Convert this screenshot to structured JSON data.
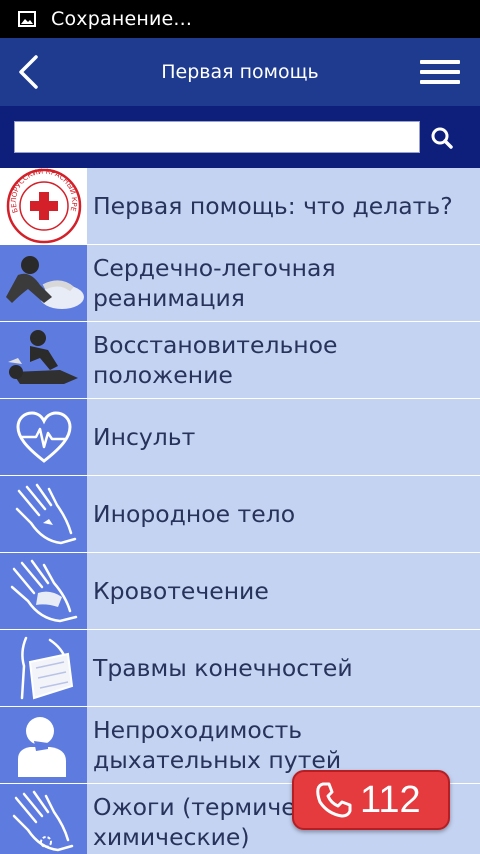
{
  "status_bar": {
    "text": "Сохранение...",
    "icon": "image-icon"
  },
  "header": {
    "title": "Первая помощь",
    "back_icon": "chevron-left-icon",
    "menu_icon": "hamburger-menu-icon",
    "bg_color": "#1f3b8f"
  },
  "search": {
    "value": "",
    "placeholder": "",
    "icon": "search-icon"
  },
  "list": {
    "items": [
      {
        "label": "Первая помощь: что делать?",
        "icon": "red-cross-logo"
      },
      {
        "label": "Сердечно-легочная реанимация",
        "icon": "cpr-icon"
      },
      {
        "label": "Восстановительное положение",
        "icon": "recovery-position-icon"
      },
      {
        "label": "Инсульт",
        "icon": "heart-pulse-icon"
      },
      {
        "label": "Инородное тело",
        "icon": "hand-foreign-body-icon"
      },
      {
        "label": "Кровотечение",
        "icon": "hand-bandage-icon"
      },
      {
        "label": "Травмы конечностей",
        "icon": "arm-sling-icon"
      },
      {
        "label": "Непроходимость дыхательных путей",
        "icon": "choking-person-icon"
      },
      {
        "label": "Ожоги (термические, химические)",
        "icon": "hand-burn-icon"
      }
    ]
  },
  "logo_text": "БЕЛОРУССКИЙ КРАСНЫЙ КРЕСТ",
  "call_button": {
    "number": "112",
    "icon": "phone-icon",
    "color": "#e53a3e"
  }
}
